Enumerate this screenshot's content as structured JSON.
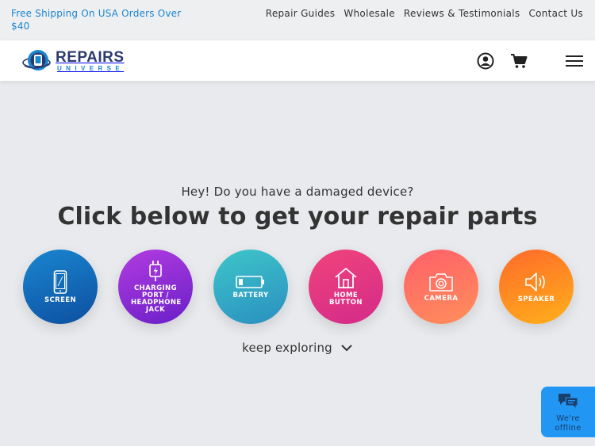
{
  "topbar": {
    "promo": "Free Shipping On USA Orders Over $40",
    "links": [
      "Repair Guides",
      "Wholesale",
      "Reviews & Testimonials",
      "Contact Us"
    ]
  },
  "header": {
    "logo_word": "REPAIRS",
    "logo_sub": "UNIVERSE",
    "icons": [
      "account-icon",
      "cart-icon",
      "menu-icon"
    ]
  },
  "hero": {
    "subhead": "Hey! Do you have a damaged device?",
    "headline": "Click below to get your repair parts",
    "categories": [
      {
        "label": "SCREEN",
        "icon": "phone-screen-icon",
        "gradient": [
          "#1a86d0",
          "#0d4fa0"
        ]
      },
      {
        "label": "CHARGING PORT / HEADPHONE JACK",
        "icon": "charging-plug-icon",
        "gradient": [
          "#b13ce0",
          "#6a1fc8"
        ]
      },
      {
        "label": "BATTERY",
        "icon": "battery-icon",
        "gradient": [
          "#3ec6c9",
          "#2a8fc0"
        ]
      },
      {
        "label": "HOME BUTTON",
        "icon": "home-icon",
        "gradient": [
          "#f0447a",
          "#d42a8a"
        ]
      },
      {
        "label": "CAMERA",
        "icon": "camera-icon",
        "gradient": [
          "#ff5f6a",
          "#ff8f5a"
        ]
      },
      {
        "label": "SPEAKER",
        "icon": "speaker-icon",
        "gradient": [
          "#ff6a2a",
          "#ffb01a"
        ]
      }
    ],
    "explore": "keep exploring"
  },
  "chat": {
    "status": "We're offline"
  },
  "colors": {
    "accent": "#1a86d0",
    "background": "#e9eaed",
    "chat": "#2196f3"
  }
}
